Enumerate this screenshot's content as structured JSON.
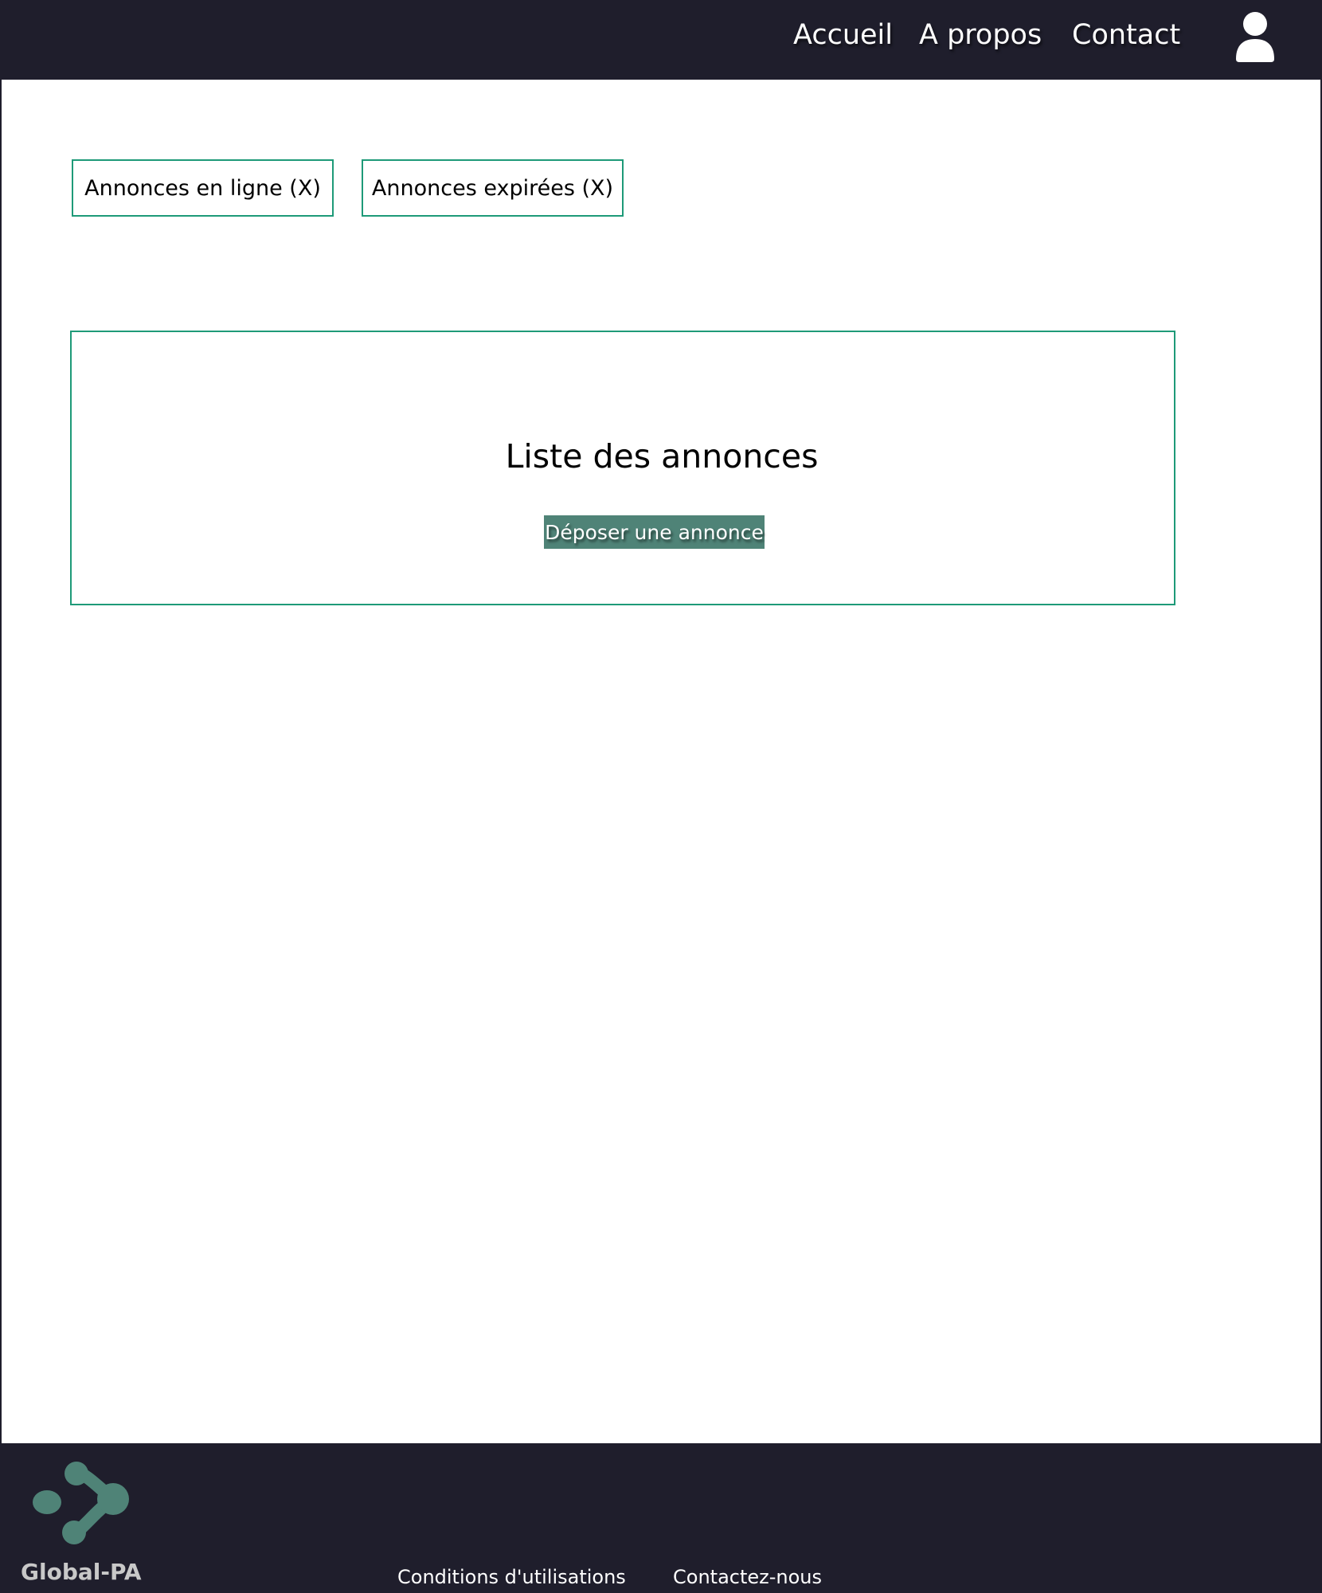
{
  "header": {
    "nav": {
      "home": "Accueil",
      "about": "A propos",
      "contact": "Contact"
    },
    "account_icon": "user-icon"
  },
  "tabs": {
    "online": "Annonces en ligne (X)",
    "expired": "Annonces expirées (X)"
  },
  "listing": {
    "title": "Liste des annonces",
    "deposit_button": "Déposer une annonce"
  },
  "footer": {
    "logo_text": "Global-PA",
    "terms_link": "Conditions d'utilisations",
    "contact_link": "Contactez-nous"
  },
  "colors": {
    "dark_navy": "#1f1e2c",
    "accent_green": "#1e9a78",
    "button_teal": "#4f8377"
  }
}
